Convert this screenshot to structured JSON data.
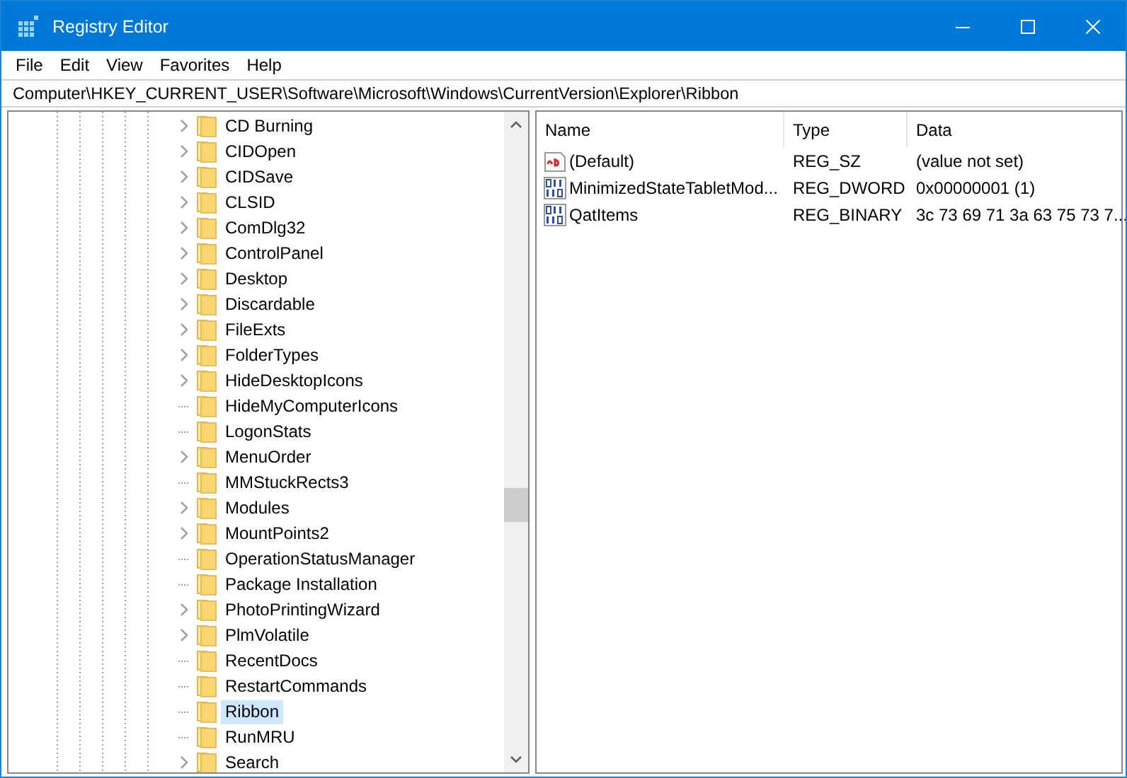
{
  "window": {
    "title": "Registry Editor"
  },
  "menu": [
    "File",
    "Edit",
    "View",
    "Favorites",
    "Help"
  ],
  "address": "Computer\\HKEY_CURRENT_USER\\Software\\Microsoft\\Windows\\CurrentVersion\\Explorer\\Ribbon",
  "tree": [
    {
      "label": "CD Burning",
      "has_children": true,
      "selected": false
    },
    {
      "label": "CIDOpen",
      "has_children": true,
      "selected": false
    },
    {
      "label": "CIDSave",
      "has_children": true,
      "selected": false
    },
    {
      "label": "CLSID",
      "has_children": true,
      "selected": false
    },
    {
      "label": "ComDlg32",
      "has_children": true,
      "selected": false
    },
    {
      "label": "ControlPanel",
      "has_children": true,
      "selected": false
    },
    {
      "label": "Desktop",
      "has_children": true,
      "selected": false
    },
    {
      "label": "Discardable",
      "has_children": true,
      "selected": false
    },
    {
      "label": "FileExts",
      "has_children": true,
      "selected": false
    },
    {
      "label": "FolderTypes",
      "has_children": true,
      "selected": false
    },
    {
      "label": "HideDesktopIcons",
      "has_children": true,
      "selected": false
    },
    {
      "label": "HideMyComputerIcons",
      "has_children": false,
      "selected": false
    },
    {
      "label": "LogonStats",
      "has_children": false,
      "selected": false
    },
    {
      "label": "MenuOrder",
      "has_children": true,
      "selected": false
    },
    {
      "label": "MMStuckRects3",
      "has_children": false,
      "selected": false
    },
    {
      "label": "Modules",
      "has_children": true,
      "selected": false
    },
    {
      "label": "MountPoints2",
      "has_children": true,
      "selected": false
    },
    {
      "label": "OperationStatusManager",
      "has_children": false,
      "selected": false
    },
    {
      "label": "Package Installation",
      "has_children": false,
      "selected": false
    },
    {
      "label": "PhotoPrintingWizard",
      "has_children": true,
      "selected": false
    },
    {
      "label": "PlmVolatile",
      "has_children": true,
      "selected": false
    },
    {
      "label": "RecentDocs",
      "has_children": false,
      "selected": false
    },
    {
      "label": "RestartCommands",
      "has_children": false,
      "selected": false
    },
    {
      "label": "Ribbon",
      "has_children": false,
      "selected": true
    },
    {
      "label": "RunMRU",
      "has_children": false,
      "selected": false
    },
    {
      "label": "Search",
      "has_children": true,
      "selected": false
    }
  ],
  "table": {
    "columns": [
      "Name",
      "Type",
      "Data"
    ],
    "rows": [
      {
        "kind": "string",
        "name": "(Default)",
        "type": "REG_SZ",
        "data": "(value not set)"
      },
      {
        "kind": "binary",
        "name": "MinimizedStateTabletMod...",
        "type": "REG_DWORD",
        "data": "0x00000001 (1)"
      },
      {
        "kind": "binary",
        "name": "QatItems",
        "type": "REG_BINARY",
        "data": "3c 73 69 71 3a 63 75 73 7..."
      }
    ]
  }
}
